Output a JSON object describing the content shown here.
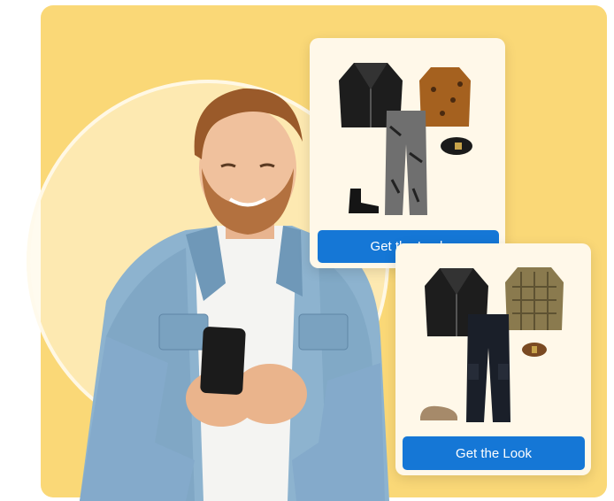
{
  "hero": {
    "illustration": "man-with-phone-in-denim-jacket"
  },
  "colors": {
    "panel_bg": "#fad877",
    "card_bg": "#fff8e9",
    "button_bg": "#1577d6"
  },
  "outfit_cards": [
    {
      "items": [
        "leather-jacket-icon",
        "leopard-cardigan-icon",
        "patterned-trousers-icon",
        "black-belt-icon",
        "black-boots-icon"
      ],
      "button_label": "Get the Look"
    },
    {
      "items": [
        "leather-jacket-icon",
        "checked-cardigan-icon",
        "cargo-pants-icon",
        "brown-belt-icon",
        "loafers-icon"
      ],
      "button_label": "Get the Look"
    }
  ]
}
